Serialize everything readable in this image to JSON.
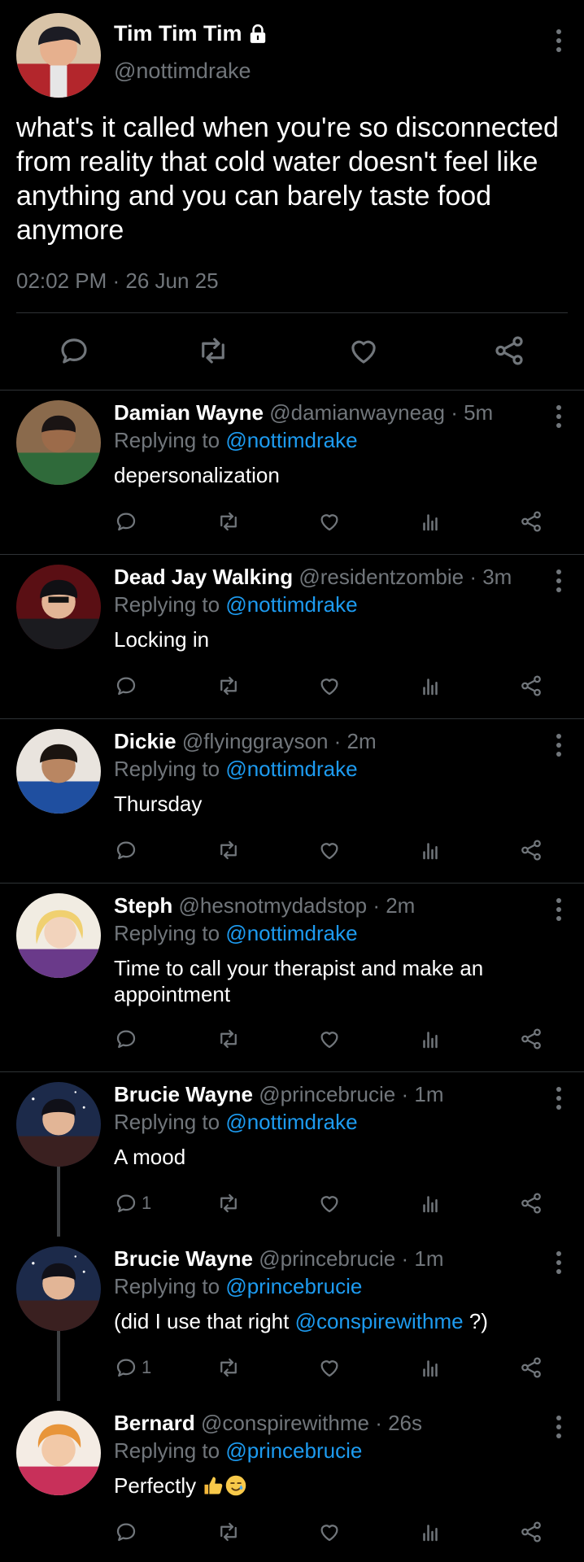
{
  "main_tweet": {
    "name": "Tim Tim Tim",
    "handle": "@nottimdrake",
    "text": "what's it called when you're so disconnected from reality that cold water doesn't feel like anything and you can barely taste food anymore",
    "timestamp": "02:02 PM · 26 Jun 25",
    "icons": [
      "lock-icon",
      "more-icon",
      "reply-icon",
      "retweet-icon",
      "like-icon",
      "share-icon"
    ]
  },
  "replies": [
    {
      "name": "Damian Wayne",
      "handle": "@damianwayneag",
      "time": "· 5m",
      "replying_to_label": "Replying to",
      "replying_to": "@nottimdrake",
      "text": "depersonalization",
      "reply_count": ""
    },
    {
      "name": "Dead Jay Walking",
      "handle": "@residentzombie",
      "time": "· 3m",
      "replying_to_label": "Replying to",
      "replying_to": "@nottimdrake",
      "text": "Locking in",
      "reply_count": ""
    },
    {
      "name": "Dickie",
      "handle": "@flyinggrayson",
      "time": "· 2m",
      "replying_to_label": "Replying to",
      "replying_to": "@nottimdrake",
      "text": "Thursday",
      "reply_count": ""
    },
    {
      "name": "Steph",
      "handle": "@hesnotmydadstop",
      "time": "· 2m",
      "replying_to_label": "Replying to",
      "replying_to": "@nottimdrake",
      "text": "Time to call your therapist and make an appointment",
      "reply_count": ""
    },
    {
      "name": "Brucie Wayne",
      "handle": "@princebrucie",
      "time": "· 1m",
      "replying_to_label": "Replying to",
      "replying_to": "@nottimdrake",
      "text": "A mood",
      "reply_count": "1"
    },
    {
      "name": "Brucie Wayne",
      "handle": "@princebrucie",
      "time": "· 1m",
      "replying_to_label": "Replying to",
      "replying_to": "@princebrucie",
      "text_before": "(did I use that right",
      "mention": "@conspirewithme",
      "text_after": "?)",
      "reply_count": "1"
    },
    {
      "name": "Bernard",
      "handle": "@conspirewithme",
      "time": "· 26s",
      "replying_to_label": "Replying to",
      "replying_to": "@princebrucie",
      "text": "Perfectly",
      "emojis": [
        "thumbs-up-emoji",
        "smiling-face-with-tear-emoji"
      ],
      "reply_count": ""
    }
  ],
  "colors": {
    "background": "#000000",
    "text": "#e7e9ea",
    "muted": "#71767b",
    "link": "#1d9bf0",
    "divider": "#2f3336"
  }
}
